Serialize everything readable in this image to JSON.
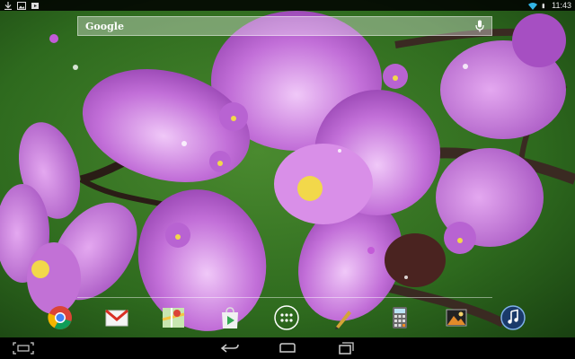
{
  "status_bar": {
    "time": "11:43",
    "left_icons": [
      "download-icon",
      "image-icon",
      "play-store-notification-icon"
    ],
    "right_icons": [
      "wifi-icon",
      "battery-icon"
    ]
  },
  "search": {
    "label": "Google",
    "mic_icon": "mic-icon"
  },
  "dock": {
    "apps": [
      "chrome-icon",
      "gmail-icon",
      "maps-icon",
      "play-store-icon",
      "app-drawer-icon",
      "pen-tool-icon",
      "calculator-icon",
      "gallery-icon",
      "music-icon"
    ]
  },
  "nav": {
    "buttons": [
      "back-icon",
      "home-icon",
      "recent-apps-icon"
    ],
    "left_icon": "screenshot-icon"
  },
  "colors": {
    "petal": "#b45ad0",
    "petal_light": "#d69ae8",
    "background": "#1f5a1a",
    "accent": "#ffffff"
  }
}
